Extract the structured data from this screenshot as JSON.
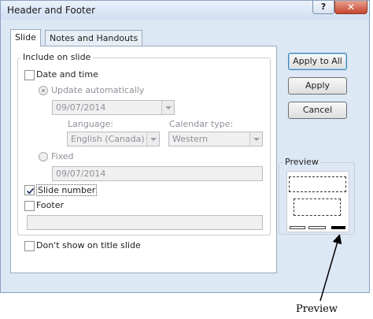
{
  "window": {
    "title": "Header and Footer",
    "help_glyph": "?",
    "close_glyph": "✕"
  },
  "tabs": [
    {
      "label": "Slide",
      "active": true
    },
    {
      "label": "Notes and Handouts",
      "active": false
    }
  ],
  "include_group": {
    "label": "Include on slide",
    "date_time": {
      "label": "Date and time",
      "checked": false
    },
    "update_auto": {
      "label": "Update automatically",
      "selected": true,
      "enabled": false
    },
    "date_value": "09/07/2014",
    "language": {
      "label": "Language:",
      "value": "English (Canada)"
    },
    "calendar": {
      "label": "Calendar type:",
      "value": "Western"
    },
    "fixed": {
      "label": "Fixed",
      "selected": false,
      "enabled": false
    },
    "fixed_value": "09/07/2014",
    "slide_number": {
      "label": "Slide number",
      "checked": true
    },
    "footer": {
      "label": "Footer",
      "checked": false,
      "value": ""
    }
  },
  "dont_show_title": {
    "label": "Don't show on title slide",
    "checked": false
  },
  "buttons": {
    "apply_all": "Apply to All",
    "apply": "Apply",
    "cancel": "Cancel"
  },
  "preview": {
    "label": "Preview",
    "slide_number_highlighted": true
  },
  "annotation": {
    "caption": "Preview"
  }
}
